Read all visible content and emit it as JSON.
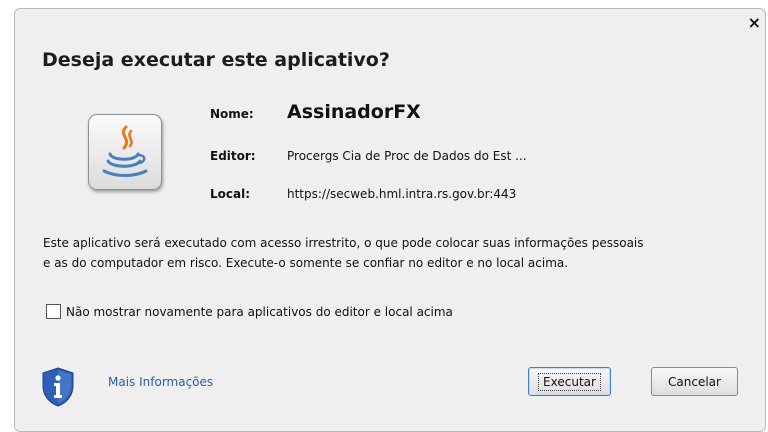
{
  "dialog": {
    "title": "Deseja executar este aplicativo?",
    "close_glyph": "×"
  },
  "app_info": {
    "name_label": "Nome:",
    "name_value": "AssinadorFX",
    "publisher_label": "Editor:",
    "publisher_value": "Procergs Cia de Proc de Dados do Est ...",
    "location_label": "Local:",
    "location_value": "https://secweb.hml.intra.rs.gov.br:443",
    "icon": "java-icon"
  },
  "warning": {
    "line1": "Este aplicativo será executado com acesso irrestrito, o que pode colocar suas informações pessoais",
    "line2": "e as do computador em risco. Execute-o somente se confiar no editor e no local acima."
  },
  "checkbox": {
    "label": "Não mostrar novamente para aplicativos do editor e local acima",
    "checked": false
  },
  "footer": {
    "more_info_label": "Mais Informações",
    "info_icon": "shield-info-icon",
    "run_label": "Executar",
    "cancel_label": "Cancelar"
  },
  "colors": {
    "background": "#efefef",
    "link": "#2a5daa",
    "shield_blue": "#2f5fb8",
    "default_button_border": "#3c7fd0",
    "java_orange": "#e8761e",
    "java_blue": "#4a7fbd"
  }
}
